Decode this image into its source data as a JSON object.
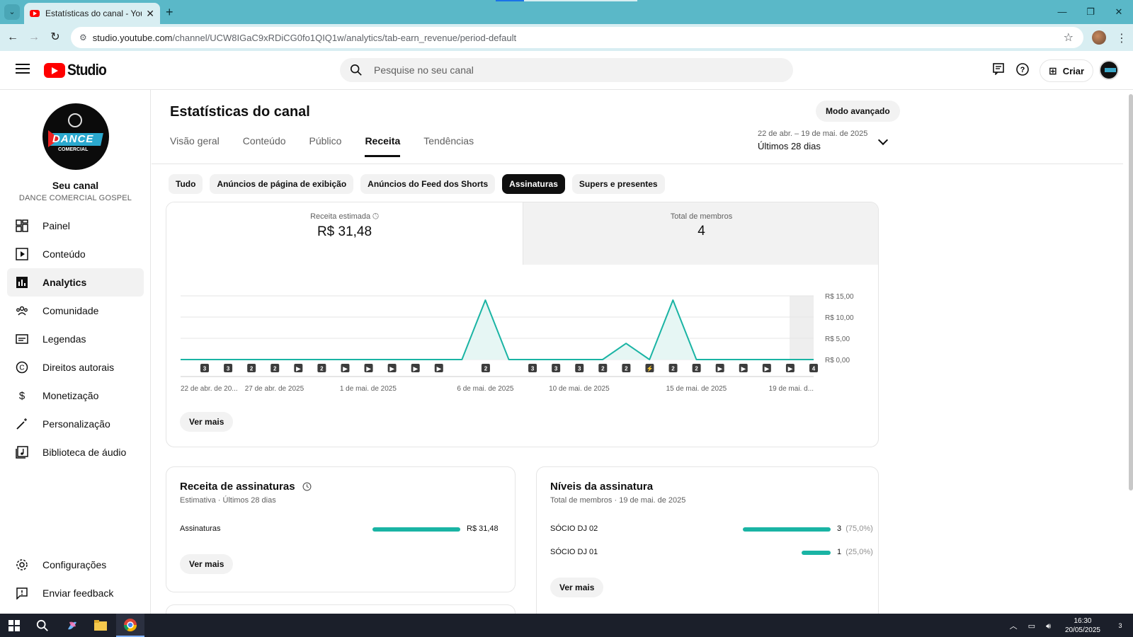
{
  "browser": {
    "tab_title": "Estatísticas do canal - YouTube",
    "url_host": "studio.youtube.com",
    "url_path": "/channel/UCW8IGaC9xRDiCG0fo1QIQ1w/analytics/tab-earn_revenue/period-default"
  },
  "header": {
    "logo_text": "Studio",
    "search_placeholder": "Pesquise no seu canal",
    "create_label": "Criar"
  },
  "sidebar": {
    "channel_label": "Seu canal",
    "channel_name": "DANCE COMERCIAL GOSPEL",
    "avatar_text": "DANCE",
    "avatar_text2": "COMERCIAL",
    "items": [
      {
        "label": "Painel",
        "icon": "dashboard-icon"
      },
      {
        "label": "Conteúdo",
        "icon": "content-icon"
      },
      {
        "label": "Analytics",
        "icon": "analytics-icon"
      },
      {
        "label": "Comunidade",
        "icon": "community-icon"
      },
      {
        "label": "Legendas",
        "icon": "subtitles-icon"
      },
      {
        "label": "Direitos autorais",
        "icon": "copyright-icon"
      },
      {
        "label": "Monetização",
        "icon": "dollar-icon"
      },
      {
        "label": "Personalização",
        "icon": "magic-wand-icon"
      },
      {
        "label": "Biblioteca de áudio",
        "icon": "audio-library-icon"
      }
    ],
    "settings_label": "Configurações",
    "feedback_label": "Enviar feedback"
  },
  "main": {
    "title": "Estatísticas do canal",
    "advanced_mode": "Modo avançado",
    "tabs": [
      "Visão geral",
      "Conteúdo",
      "Público",
      "Receita",
      "Tendências"
    ],
    "active_tab": 3,
    "date_range_small": "22 de abr. – 19 de mai. de 2025",
    "date_range_label": "Últimos 28 dias",
    "chips": [
      "Tudo",
      "Anúncios de página de exibição",
      "Anúncios do Feed dos Shorts",
      "Assinaturas",
      "Supers e presentes"
    ],
    "active_chip": 3,
    "kpi_revenue_label": "Receita estimada",
    "kpi_revenue_value": "R$ 31,48",
    "kpi_members_label": "Total de membros",
    "kpi_members_value": "4",
    "ver_mais": "Ver mais"
  },
  "chart_data": {
    "type": "area",
    "x": [
      "22/04",
      "23/04",
      "24/04",
      "25/04",
      "26/04",
      "27/04",
      "28/04",
      "29/04",
      "30/04",
      "01/05",
      "02/05",
      "03/05",
      "04/05",
      "05/05",
      "06/05",
      "07/05",
      "08/05",
      "09/05",
      "10/05",
      "11/05",
      "12/05",
      "13/05",
      "14/05",
      "15/05",
      "16/05",
      "17/05",
      "18/05",
      "19/05"
    ],
    "values": [
      0,
      0,
      0,
      0,
      0,
      0,
      0,
      0,
      0,
      0,
      0,
      0,
      0,
      14,
      0,
      0,
      0,
      0,
      0,
      3.8,
      0,
      14,
      0,
      0,
      0,
      0,
      0,
      0
    ],
    "ylim": [
      0,
      15
    ],
    "y_ticks": [
      "R$ 0,00",
      "R$ 5,00",
      "R$ 10,00",
      "R$ 15,00"
    ],
    "y_tick_values": [
      0,
      5,
      10,
      15
    ],
    "x_tick_labels": [
      "22 de abr. de 20...",
      "27 de abr. de 2025",
      "1 de mai. de 2025",
      "6 de mai. de 2025",
      "10 de mai. de 2025",
      "15 de mai. de 2025",
      "19 de mai. d..."
    ],
    "x_tick_index": [
      0,
      4,
      8,
      13,
      17,
      22,
      26
    ],
    "markers": [
      "3",
      "3",
      "2",
      "2",
      "▶",
      "2",
      "▶",
      "▶",
      "▶",
      "▶",
      "▶",
      "",
      "2",
      "",
      "3",
      "3",
      "3",
      "2",
      "2",
      "⚡",
      "2",
      "2",
      "▶",
      "▶",
      "▶",
      "▶",
      "4"
    ],
    "line_color": "#1ab4a4",
    "fill_color": "#e6f6f4",
    "grid": true
  },
  "subs_revenue": {
    "title": "Receita de assinaturas",
    "subtitle": "Estimativa · Últimos 28 dias",
    "rows": [
      {
        "label": "Assinaturas",
        "value": "R$ 31,48",
        "fraction": 1.0
      }
    ]
  },
  "subs_levels": {
    "title": "Níveis da assinatura",
    "subtitle": "Total de membros · 19 de mai. de 2025",
    "rows": [
      {
        "label": "SÓCIO DJ 02",
        "value": "3",
        "pct": "(75,0%)",
        "fraction": 0.75
      },
      {
        "label": "SÓCIO DJ 01",
        "value": "1",
        "pct": "(25,0%)",
        "fraction": 0.25
      }
    ]
  },
  "taskbar": {
    "time": "16:30",
    "date": "20/05/2025",
    "notif_count": "3"
  },
  "colors": {
    "accent": "#1ab4a4",
    "yt_red": "#ff0000",
    "browser_frame": "#5ab8c8"
  }
}
